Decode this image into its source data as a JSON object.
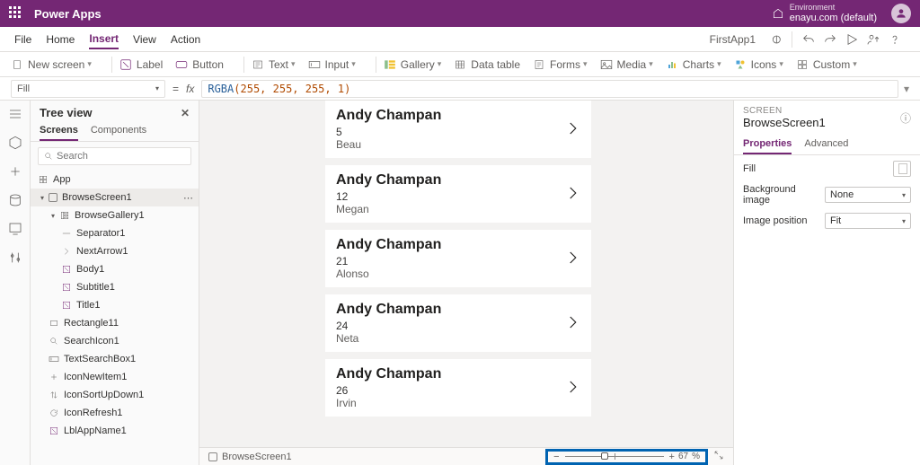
{
  "header": {
    "brand": "Power Apps",
    "env_label": "Environment",
    "env_name": "enayu.com (default)"
  },
  "menu": {
    "items": [
      "File",
      "Home",
      "Insert",
      "View",
      "Action"
    ],
    "active": "Insert",
    "app_name": "FirstApp1"
  },
  "ribbon": {
    "new_screen": "New screen",
    "label": "Label",
    "button": "Button",
    "text": "Text",
    "input": "Input",
    "gallery": "Gallery",
    "data_table": "Data table",
    "forms": "Forms",
    "media": "Media",
    "charts": "Charts",
    "icons": "Icons",
    "custom": "Custom"
  },
  "formula": {
    "property": "Fill",
    "fx": "fx",
    "func": "RGBA",
    "args": "(255, 255, 255, 1)"
  },
  "tree": {
    "title": "Tree view",
    "tabs": {
      "screens": "Screens",
      "components": "Components"
    },
    "search_placeholder": "Search",
    "nodes": {
      "app": "App",
      "browse_screen": "BrowseScreen1",
      "browse_gallery": "BrowseGallery1",
      "separator": "Separator1",
      "next_arrow": "NextArrow1",
      "body": "Body1",
      "subtitle": "Subtitle1",
      "title": "Title1",
      "rectangle": "Rectangle11",
      "search_icon": "SearchIcon1",
      "text_search_box": "TextSearchBox1",
      "icon_new": "IconNewItem1",
      "icon_sort": "IconSortUpDown1",
      "icon_refresh": "IconRefresh1",
      "lbl_appname": "LblAppName1"
    }
  },
  "gallery": [
    {
      "name": "Andy Champan",
      "n": "5",
      "sub": "Beau"
    },
    {
      "name": "Andy Champan",
      "n": "12",
      "sub": "Megan"
    },
    {
      "name": "Andy Champan",
      "n": "21",
      "sub": "Alonso"
    },
    {
      "name": "Andy Champan",
      "n": "24",
      "sub": "Neta"
    },
    {
      "name": "Andy Champan",
      "n": "26",
      "sub": "Irvin"
    }
  ],
  "status": {
    "selected": "BrowseScreen1",
    "zoom": "67",
    "zoom_unit": "%"
  },
  "props": {
    "type": "SCREEN",
    "name": "BrowseScreen1",
    "tabs": {
      "properties": "Properties",
      "advanced": "Advanced"
    },
    "fill_label": "Fill",
    "bg_image_label": "Background image",
    "bg_image_value": "None",
    "img_pos_label": "Image position",
    "img_pos_value": "Fit"
  }
}
